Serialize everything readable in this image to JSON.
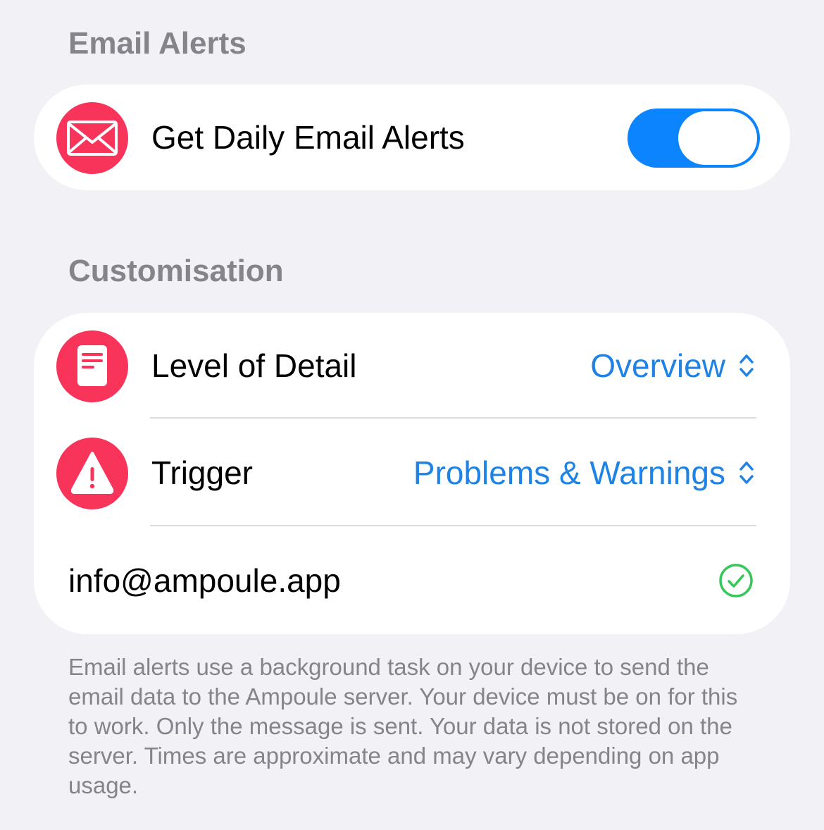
{
  "sections": {
    "email_alerts": {
      "header": "Email Alerts",
      "toggle_row": {
        "label": "Get Daily Email Alerts",
        "icon": "envelope-icon",
        "toggle_on": true
      }
    },
    "customisation": {
      "header": "Customisation",
      "rows": [
        {
          "label": "Level of Detail",
          "value": "Overview",
          "icon": "document-icon"
        },
        {
          "label": "Trigger",
          "value": "Problems & Warnings",
          "icon": "warning-icon"
        }
      ],
      "email": {
        "address": "info@ampoule.app",
        "status_icon": "checkmark-circle-icon"
      }
    }
  },
  "footer": {
    "text": "Email alerts use a background task on your device to send the email data to the Ampoule server. Your device must be on for this to work. Only the message is sent. Your data is not stored on the server. Times are approximate and may vary depending on app usage."
  },
  "colors": {
    "background": "#F2F1F6",
    "card": "#FFFFFF",
    "header_text": "#85848B",
    "icon_background": "#F8345A",
    "accent_blue": "#1E83E5",
    "toggle_on": "#0B84FE",
    "check_green": "#34C759",
    "separator": "#DCDCE0"
  }
}
